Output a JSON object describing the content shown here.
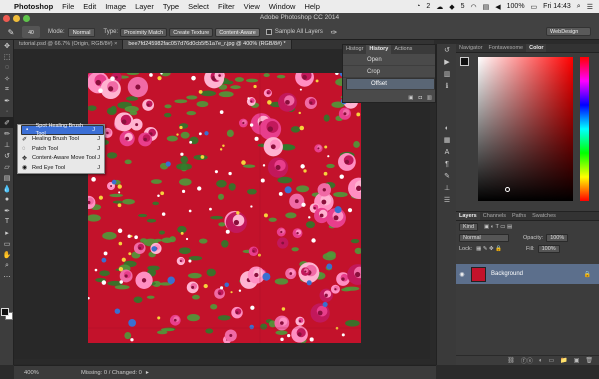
{
  "menubar": {
    "app": "Photoshop",
    "items": [
      "File",
      "Edit",
      "Image",
      "Layer",
      "Type",
      "Select",
      "Filter",
      "View",
      "Window",
      "Help"
    ],
    "status_right": [
      "2",
      "5",
      "100%",
      "Fri 14:43"
    ]
  },
  "window": {
    "title": "Adobe Photoshop CC 2014"
  },
  "options": {
    "brush_size": "40",
    "mode_label": "Mode:",
    "mode_value": "Normal",
    "type_label": "Type:",
    "type_buttons": [
      "Proximity Match",
      "Create Texture",
      "Content-Aware"
    ],
    "sample_all_layers": "Sample All Layers",
    "workspace": "WebDesign"
  },
  "tabs": [
    {
      "label": "tutorial.psd @ 66.7% (Origin, RGB/8#) ×"
    },
    {
      "label": "bee7fd245982fac057d76d0cb5f51a7e_r.jpg @ 400% (RGB/8#) *"
    }
  ],
  "flyout": {
    "items": [
      {
        "label": "Spot Healing Brush Tool",
        "key": "J"
      },
      {
        "label": "Healing Brush Tool",
        "key": "J"
      },
      {
        "label": "Patch Tool",
        "key": "J"
      },
      {
        "label": "Content-Aware Move Tool",
        "key": "J"
      },
      {
        "label": "Red Eye Tool",
        "key": "J"
      }
    ]
  },
  "history": {
    "tabs": [
      "Histogr",
      "History",
      "Actions"
    ],
    "items": [
      "Open",
      "Crop",
      "Offset"
    ]
  },
  "right_panel": {
    "top_tabs": [
      "Navigator",
      "Fontawesome",
      "Color"
    ],
    "color": {
      "foreground": "#111111",
      "background": "#ffffff",
      "hue": "#ff0000"
    },
    "layers_tabs": [
      "Layers",
      "Channels",
      "Paths",
      "Swatches"
    ],
    "kind": "Kind",
    "blend_mode": "Normal",
    "opacity_label": "Opacity:",
    "opacity_value": "100%",
    "lock_label": "Lock:",
    "fill_label": "Fill:",
    "fill_value": "100%",
    "layer_name": "Background",
    "footer_icons": [
      "ⓕⓧ",
      "◐",
      "▭",
      "📁",
      "▣",
      "🗑"
    ]
  },
  "status": {
    "zoom": "400%",
    "info": "Missing: 0 / Changed: 0"
  },
  "colors": {
    "fabric_red": "#c3122b",
    "history_selected": "#5a6675",
    "layer_selected": "#5c6f8c",
    "flyout_selected": "#3b6fd6"
  }
}
